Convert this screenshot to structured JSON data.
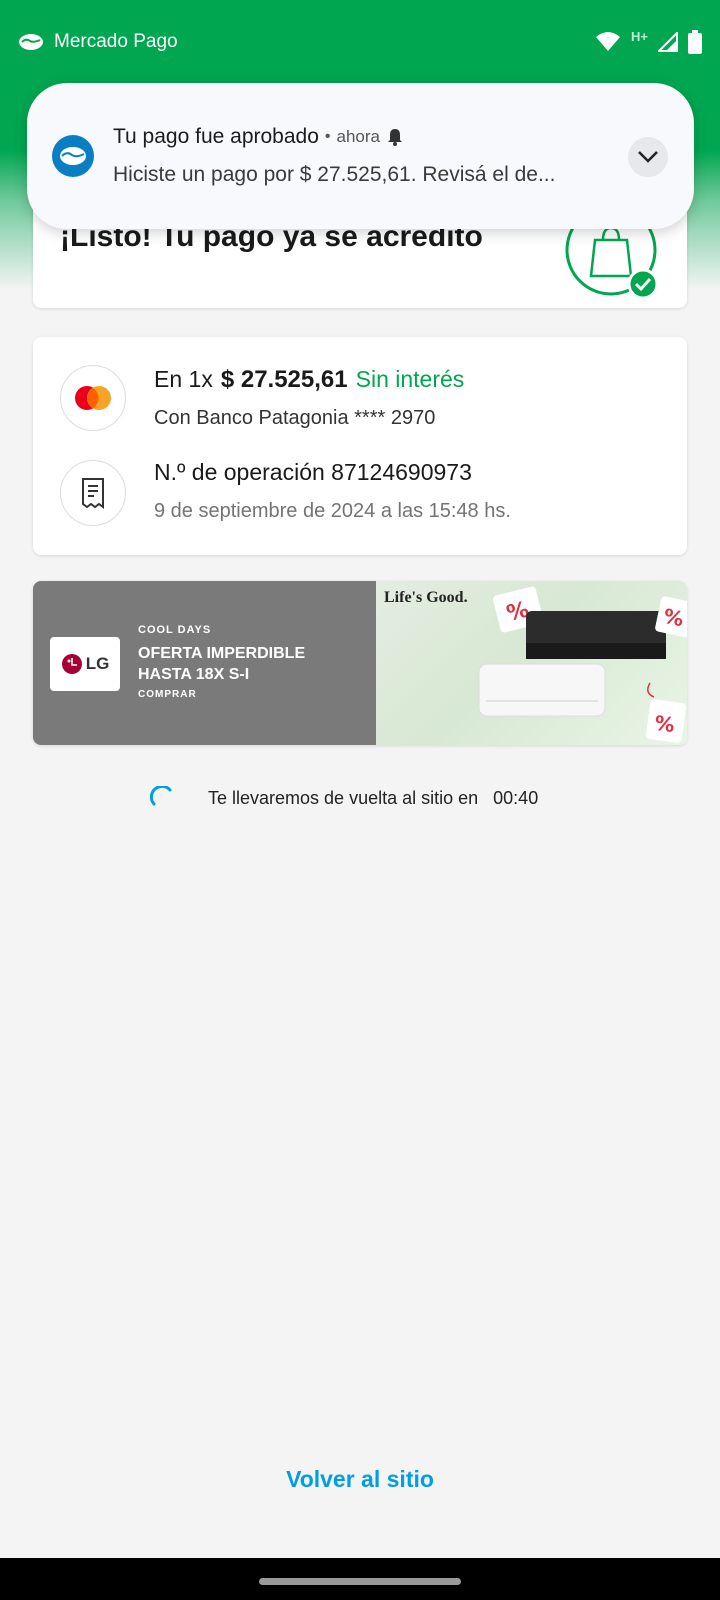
{
  "status_bar": {
    "app_name": "Mercado Pago",
    "network": "H+"
  },
  "notification": {
    "title": "Tu pago fue aprobado",
    "separator": "•",
    "time": "ahora",
    "body": "Hiciste un pago por $ 27.525,61. Revisá el de..."
  },
  "success": {
    "title": "¡Listo! Tu pago ya se acreditó"
  },
  "payment": {
    "installments": "En 1x",
    "amount": "$ 27.525,61",
    "interest": "Sin interés",
    "bank": "Con Banco Patagonia **** 2970",
    "operation": "N.º de operación 87124690973",
    "date": "9 de septiembre de 2024 a las 15:48 hs."
  },
  "banner": {
    "logo_text": "LG",
    "eyebrow": "COOL DAYS",
    "offer": "OFERTA IMPERDIBLE HASTA 18X S-I",
    "cta": "COMPRAR",
    "brand_tagline": "Life's Good."
  },
  "redirect": {
    "message": "Te llevaremos de vuelta al sitio en",
    "countdown": "00:40"
  },
  "actions": {
    "back_label": "Volver al sitio"
  },
  "colors": {
    "brand_green": "#00a650",
    "link_blue": "#009ee3",
    "notif_icon_blue": "#0a7ec2"
  },
  "icons": {
    "app": "mercado-pago-handshake-icon",
    "wifi": "wifi-icon",
    "signal": "signal-icon",
    "battery": "battery-icon",
    "bell": "bell-icon",
    "expand": "chevron-down-icon",
    "bag": "shopping-bag-check-icon",
    "card": "mastercard-icon",
    "receipt": "receipt-icon",
    "loader": "spinner-icon"
  }
}
